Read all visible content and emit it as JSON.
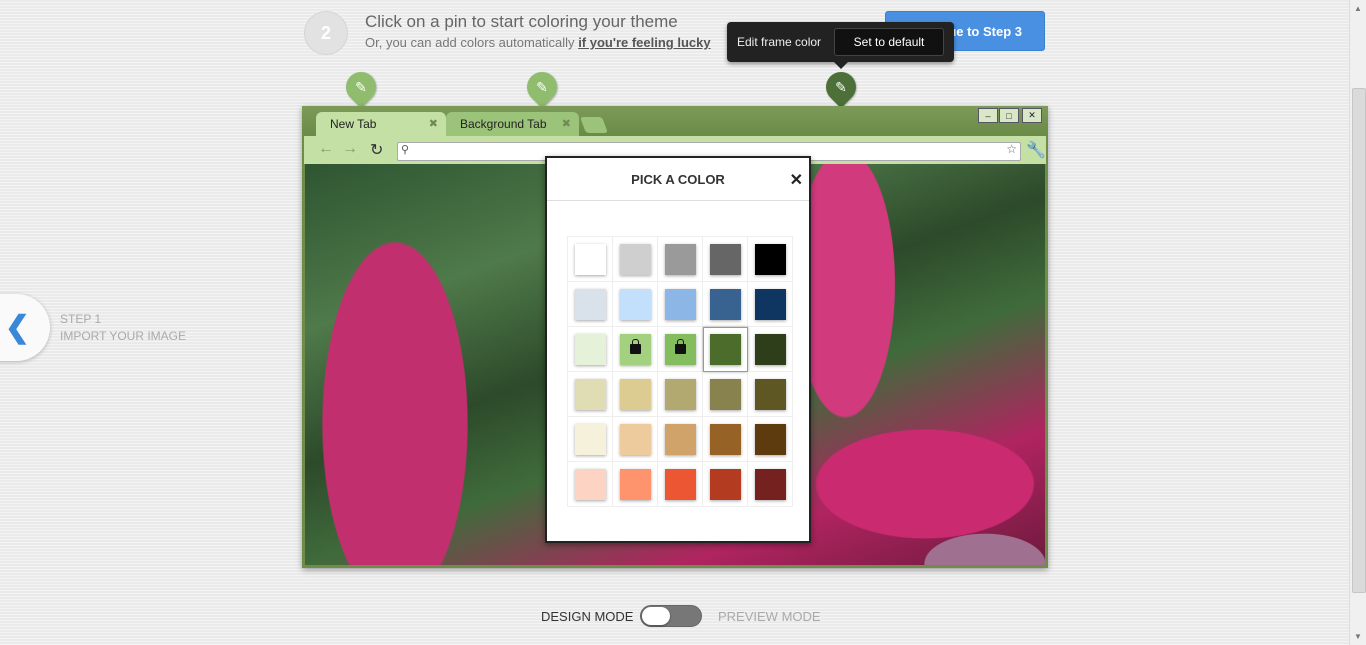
{
  "step": {
    "number": "2",
    "title": "Click on a pin to start coloring your theme",
    "subtitle_prefix": "Or, you can add colors automatically",
    "lucky_link": "if you're feeling lucky",
    "continue_label": "ue to Step 3"
  },
  "tooltip": {
    "label": "Edit frame color",
    "default_button": "Set to default"
  },
  "pins": [
    {
      "name": "tab-pin",
      "icon": "brush-icon",
      "active": false
    },
    {
      "name": "toolbar-pin",
      "icon": "brush-icon",
      "active": false
    },
    {
      "name": "frame-pin",
      "icon": "brush-icon",
      "active": true
    }
  ],
  "browser": {
    "tabs": [
      {
        "label": "New Tab"
      },
      {
        "label": "Background Tab"
      }
    ]
  },
  "picker": {
    "title": "PICK A COLOR",
    "colors": [
      [
        "#ffffff",
        "#cfcfcf",
        "#9a9a9a",
        "#666666",
        "#000000"
      ],
      [
        "#d9e1ea",
        "#c2e0fb",
        "#8bb6e6",
        "#386391",
        "#0f3660"
      ],
      [
        "#e5f2d9",
        "#a3d17f",
        "#84bd5e",
        "#4c6c2b",
        "#2e3e1b"
      ],
      [
        "#e0dcb3",
        "#dccc92",
        "#b1a96f",
        "#88824e",
        "#5e5724"
      ],
      [
        "#f6f1da",
        "#eecb9c",
        "#cfa369",
        "#966225",
        "#5e3b0e"
      ],
      [
        "#fdd3c3",
        "#fe946e",
        "#ec5632",
        "#b23b20",
        "#742120"
      ]
    ],
    "locked": [
      [
        2,
        1
      ],
      [
        2,
        2
      ]
    ],
    "selected": [
      2,
      3
    ]
  },
  "back_nav": {
    "step_label": "STEP 1",
    "step_name": "IMPORT YOUR IMAGE"
  },
  "mode": {
    "design": "DESIGN MODE",
    "preview": "PREVIEW MODE"
  }
}
